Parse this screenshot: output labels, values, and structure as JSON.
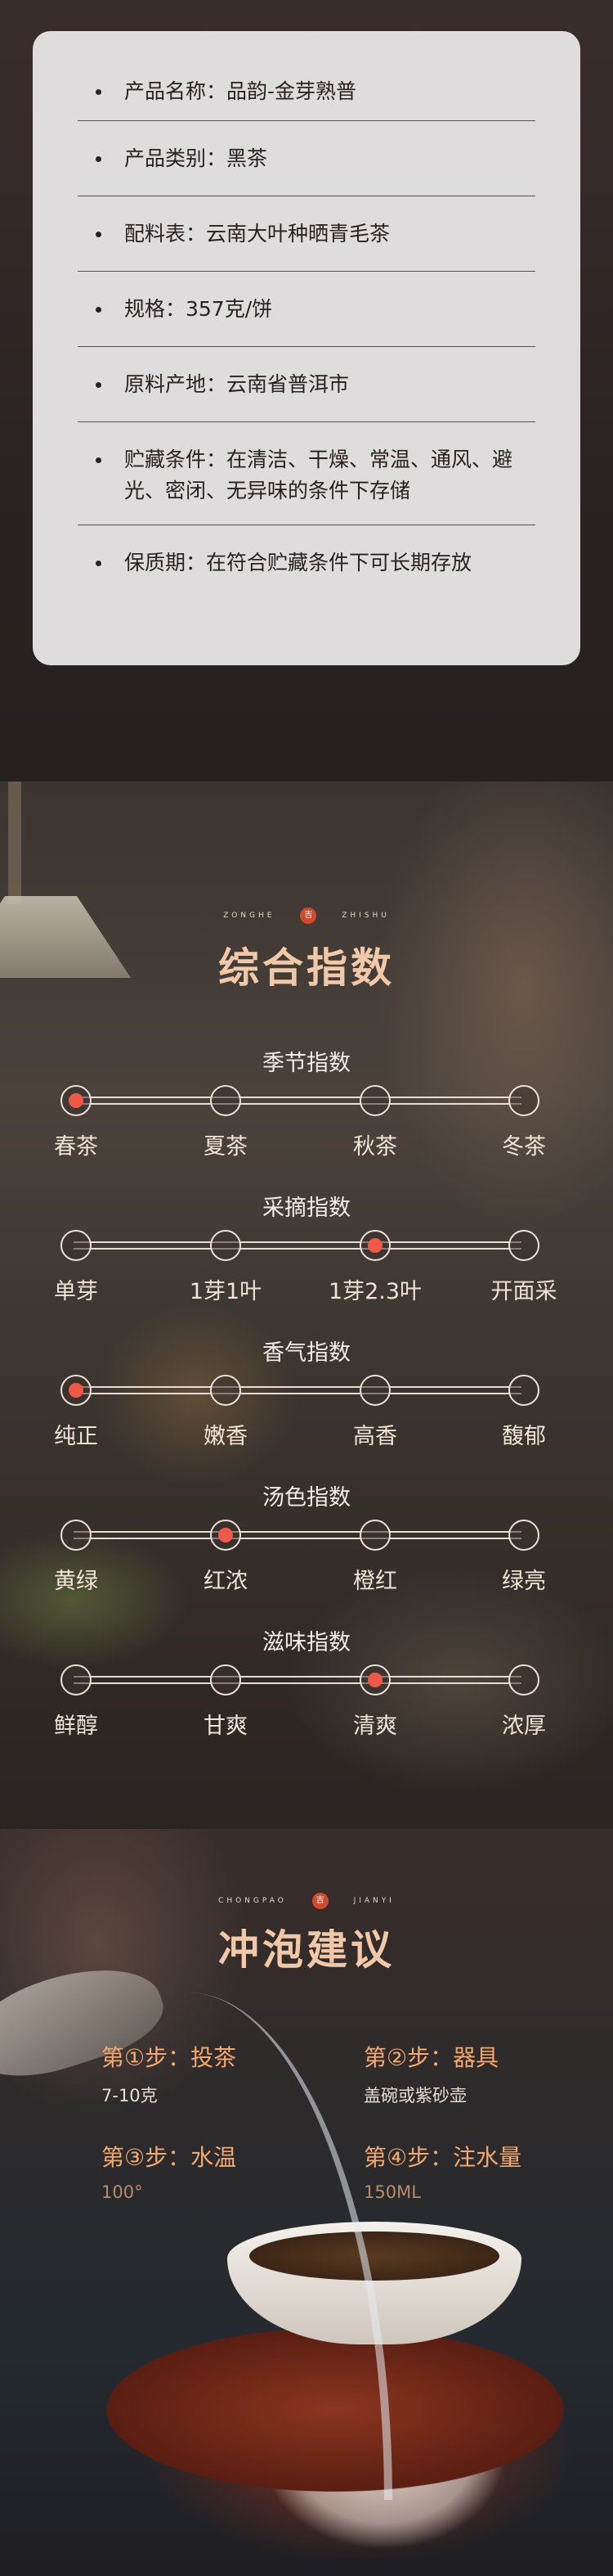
{
  "product_info": {
    "rows": [
      {
        "text": "产品名称：品韵-金芽熟普"
      },
      {
        "text": "产品类别：黑茶"
      },
      {
        "text": "配料表：云南大叶种晒青毛茶"
      },
      {
        "text": "规格：357克/饼"
      },
      {
        "text": "原料产地：云南省普洱市"
      },
      {
        "text": "贮藏条件：在清洁、干燥、常温、通风、避光、密闭、无异味的条件下存储"
      },
      {
        "text": "保质期：在符合贮藏条件下可长期存放"
      }
    ]
  },
  "indices": {
    "header_en_left": "ZONGHE",
    "header_en_right": "ZHISHU",
    "seal": "吉",
    "title": "综合指数",
    "scales": [
      {
        "title": "季节指数",
        "labels": [
          "春茶",
          "夏茶",
          "秋茶",
          "冬茶"
        ],
        "active_index": 0
      },
      {
        "title": "采摘指数",
        "labels": [
          "单芽",
          "1芽1叶",
          "1芽2.3叶",
          "开面采"
        ],
        "active_index": 2
      },
      {
        "title": "香气指数",
        "labels": [
          "纯正",
          "嫩香",
          "高香",
          "馥郁"
        ],
        "active_index": 0
      },
      {
        "title": "汤色指数",
        "labels": [
          "黄绿",
          "红浓",
          "橙红",
          "绿亮"
        ],
        "active_index": 1
      },
      {
        "title": "滋味指数",
        "labels": [
          "鲜醇",
          "甘爽",
          "清爽",
          "浓厚"
        ],
        "active_index": 2
      }
    ]
  },
  "brewing": {
    "header_en_left": "CHONGPAO",
    "header_en_right": "JIANYI",
    "seal": "吉",
    "title": "冲泡建议",
    "steps": [
      {
        "title": "第①步：投茶",
        "value": "7-10克"
      },
      {
        "title": "第②步：器具",
        "value": "盖碗或紫砂壶"
      },
      {
        "title": "第③步：水温",
        "value": "100°"
      },
      {
        "title": "第④步：注水量",
        "value": "150ML"
      }
    ]
  },
  "colors": {
    "accent": "#f1c9a8",
    "active_dot": "#ef5a48",
    "step_title": "#f3a86f",
    "card_bg": "#dedcdc"
  }
}
